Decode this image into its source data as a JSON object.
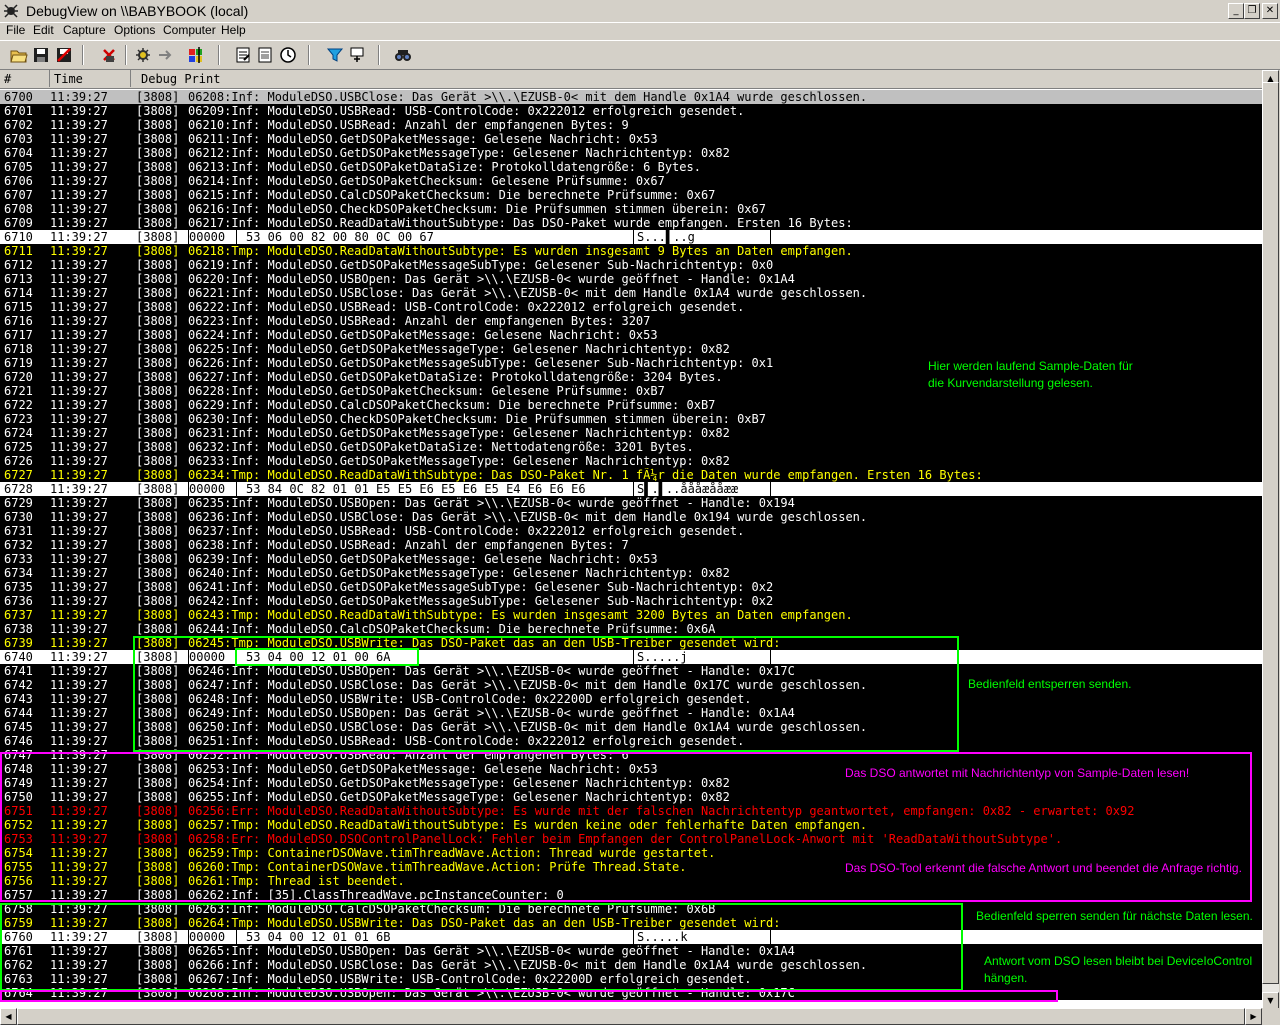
{
  "window": {
    "title": "DebugView on \\\\BABYBOOK (local)",
    "minimize_glyph": "_",
    "restore_glyph": "❐",
    "close_glyph": "✕"
  },
  "menu": [
    "File",
    "Edit",
    "Capture",
    "Options",
    "Computer",
    "Help"
  ],
  "toolbar_icons": [
    "open-icon",
    "save-icon",
    "clear-save-icon",
    "erase-icon",
    "capture-icon",
    "autoscroll-icon",
    "capture-win32-icon",
    "clock-icon",
    "history-icon",
    "highlight-icon",
    "filter-icon",
    "find-icon"
  ],
  "columns": [
    "#",
    "Time",
    "Debug Print"
  ],
  "colors": {
    "row_bg": "#000000",
    "text_default": "#ffffff",
    "text_tmp": "#ffff00",
    "text_err": "#ff0000",
    "hex_row_bg": "#ffffff",
    "box_green": "#00ff00",
    "box_magenta": "#ff00ff"
  },
  "rows": [
    {
      "n": "6700",
      "t": "11:39:27",
      "pid": "[3808]",
      "m": "06208:Inf: ModuleDSO.USBClose: Das Gerät >\\\\.\\EZUSB-0< mit dem Handle 0x1A4 wurde geschlossen.",
      "k": "sel"
    },
    {
      "n": "6701",
      "t": "11:39:27",
      "pid": "[3808]",
      "m": "06209:Inf: ModuleDSO.USBRead: USB-ControlCode: 0x222012 erfolgreich gesendet.",
      "k": "inf"
    },
    {
      "n": "6702",
      "t": "11:39:27",
      "pid": "[3808]",
      "m": "06210:Inf: ModuleDSO.USBRead: Anzahl der empfangenen Bytes: 9",
      "k": "inf"
    },
    {
      "n": "6703",
      "t": "11:39:27",
      "pid": "[3808]",
      "m": "06211:Inf: ModuleDSO.GetDSOPaketMessage: Gelesene Nachricht: 0x53",
      "k": "inf"
    },
    {
      "n": "6704",
      "t": "11:39:27",
      "pid": "[3808]",
      "m": "06212:Inf: ModuleDSO.GetDSOPaketMessageType: Gelesener Nachrichtentyp: 0x82",
      "k": "inf"
    },
    {
      "n": "6705",
      "t": "11:39:27",
      "pid": "[3808]",
      "m": "06213:Inf: ModuleDSO.GetDSOPaketDataSize: Protokolldatengröße: 6 Bytes.",
      "k": "inf"
    },
    {
      "n": "6706",
      "t": "11:39:27",
      "pid": "[3808]",
      "m": "06214:Inf: ModuleDSO.GetDSOPaketChecksum: Gelesene Prüfsumme: 0x67",
      "k": "inf"
    },
    {
      "n": "6707",
      "t": "11:39:27",
      "pid": "[3808]",
      "m": "06215:Inf: ModuleDSO.CalcDSOPaketChecksum: Die berechnete Prüfsumme: 0x67",
      "k": "inf"
    },
    {
      "n": "6708",
      "t": "11:39:27",
      "pid": "[3808]",
      "m": "06216:Inf: ModuleDSO.CheckDSOPaketChecksum: Die Prüfsummen stimmen überein: 0x67",
      "k": "inf"
    },
    {
      "n": "6709",
      "t": "11:39:27",
      "pid": "[3808]",
      "m": "06217:Inf: ModuleDSO.ReadDataWithoutSubtype: Das DSO-Paket wurde empfangen. Ersten 16 Bytes:",
      "k": "inf"
    },
    {
      "n": "6710",
      "t": "11:39:27",
      "pid": "[3808]",
      "m": "00000",
      "hex": "53 06 00 82 00 80 0C 00 67",
      "asc": "S...▌..g",
      "k": "hex"
    },
    {
      "n": "6711",
      "t": "11:39:27",
      "pid": "[3808]",
      "m": "06218:Tmp: ModuleDSO.ReadDataWithoutSubtype: Es wurden insgesamt 9 Bytes an Daten empfangen.",
      "k": "tmp"
    },
    {
      "n": "6712",
      "t": "11:39:27",
      "pid": "[3808]",
      "m": "06219:Inf: ModuleDSO.GetDSOPaketMessageSubType: Gelesener Sub-Nachrichtentyp: 0x0",
      "k": "inf"
    },
    {
      "n": "6713",
      "t": "11:39:27",
      "pid": "[3808]",
      "m": "06220:Inf: ModuleDSO.USBOpen: Das Gerät >\\\\.\\EZUSB-0< wurde geöffnet - Handle: 0x1A4",
      "k": "inf"
    },
    {
      "n": "6714",
      "t": "11:39:27",
      "pid": "[3808]",
      "m": "06221:Inf: ModuleDSO.USBClose: Das Gerät >\\\\.\\EZUSB-0< mit dem Handle 0x1A4 wurde geschlossen.",
      "k": "inf"
    },
    {
      "n": "6715",
      "t": "11:39:27",
      "pid": "[3808]",
      "m": "06222:Inf: ModuleDSO.USBRead: USB-ControlCode: 0x222012 erfolgreich gesendet.",
      "k": "inf"
    },
    {
      "n": "6716",
      "t": "11:39:27",
      "pid": "[3808]",
      "m": "06223:Inf: ModuleDSO.USBRead: Anzahl der empfangenen Bytes: 3207",
      "k": "inf"
    },
    {
      "n": "6717",
      "t": "11:39:27",
      "pid": "[3808]",
      "m": "06224:Inf: ModuleDSO.GetDSOPaketMessage: Gelesene Nachricht: 0x53",
      "k": "inf"
    },
    {
      "n": "6718",
      "t": "11:39:27",
      "pid": "[3808]",
      "m": "06225:Inf: ModuleDSO.GetDSOPaketMessageType: Gelesener Nachrichtentyp: 0x82",
      "k": "inf"
    },
    {
      "n": "6719",
      "t": "11:39:27",
      "pid": "[3808]",
      "m": "06226:Inf: ModuleDSO.GetDSOPaketMessageSubType: Gelesener Sub-Nachrichtentyp: 0x1",
      "k": "inf"
    },
    {
      "n": "6720",
      "t": "11:39:27",
      "pid": "[3808]",
      "m": "06227:Inf: ModuleDSO.GetDSOPaketDataSize: Protokolldatengröße: 3204 Bytes.",
      "k": "inf"
    },
    {
      "n": "6721",
      "t": "11:39:27",
      "pid": "[3808]",
      "m": "06228:Inf: ModuleDSO.GetDSOPaketChecksum: Gelesene Prüfsumme: 0xB7",
      "k": "inf"
    },
    {
      "n": "6722",
      "t": "11:39:27",
      "pid": "[3808]",
      "m": "06229:Inf: ModuleDSO.CalcDSOPaketChecksum: Die berechnete Prüfsumme: 0xB7",
      "k": "inf"
    },
    {
      "n": "6723",
      "t": "11:39:27",
      "pid": "[3808]",
      "m": "06230:Inf: ModuleDSO.CheckDSOPaketChecksum: Die Prüfsummen stimmen überein: 0xB7",
      "k": "inf"
    },
    {
      "n": "6724",
      "t": "11:39:27",
      "pid": "[3808]",
      "m": "06231:Inf: ModuleDSO.GetDSOPaketMessageType: Gelesener Nachrichtentyp: 0x82",
      "k": "inf"
    },
    {
      "n": "6725",
      "t": "11:39:27",
      "pid": "[3808]",
      "m": "06232:Inf: ModuleDSO.GetDSOPaketDataSize: Nettodatengröße: 3201 Bytes.",
      "k": "inf"
    },
    {
      "n": "6726",
      "t": "11:39:27",
      "pid": "[3808]",
      "m": "06233:Inf: ModuleDSO.GetDSOPaketMessageType: Gelesener Nachrichtentyp: 0x82",
      "k": "inf"
    },
    {
      "n": "6727",
      "t": "11:39:27",
      "pid": "[3808]",
      "m": "06234:Tmp: ModuleDSO.ReadDataWithSubtype: Das DSO-Paket Nr. 1 fÃ¼r die Daten wurde empfangen. Ersten 16 Bytes:",
      "k": "tmp"
    },
    {
      "n": "6728",
      "t": "11:39:27",
      "pid": "[3808]",
      "m": "00000",
      "hex": "53 84 0C 82 01 01 E5 E5 E6 E5 E6 E5 E4 E6 E6 E6",
      "asc": "S▌.▌..åååæååææ",
      "k": "hex"
    },
    {
      "n": "6729",
      "t": "11:39:27",
      "pid": "[3808]",
      "m": "06235:Inf: ModuleDSO.USBOpen: Das Gerät >\\\\.\\EZUSB-0< wurde geöffnet - Handle: 0x194",
      "k": "inf"
    },
    {
      "n": "6730",
      "t": "11:39:27",
      "pid": "[3808]",
      "m": "06236:Inf: ModuleDSO.USBClose: Das Gerät >\\\\.\\EZUSB-0< mit dem Handle 0x194 wurde geschlossen.",
      "k": "inf"
    },
    {
      "n": "6731",
      "t": "11:39:27",
      "pid": "[3808]",
      "m": "06237:Inf: ModuleDSO.USBRead: USB-ControlCode: 0x222012 erfolgreich gesendet.",
      "k": "inf"
    },
    {
      "n": "6732",
      "t": "11:39:27",
      "pid": "[3808]",
      "m": "06238:Inf: ModuleDSO.USBRead: Anzahl der empfangenen Bytes: 7",
      "k": "inf"
    },
    {
      "n": "6733",
      "t": "11:39:27",
      "pid": "[3808]",
      "m": "06239:Inf: ModuleDSO.GetDSOPaketMessage: Gelesene Nachricht: 0x53",
      "k": "inf"
    },
    {
      "n": "6734",
      "t": "11:39:27",
      "pid": "[3808]",
      "m": "06240:Inf: ModuleDSO.GetDSOPaketMessageType: Gelesener Nachrichtentyp: 0x82",
      "k": "inf"
    },
    {
      "n": "6735",
      "t": "11:39:27",
      "pid": "[3808]",
      "m": "06241:Inf: ModuleDSO.GetDSOPaketMessageSubType: Gelesener Sub-Nachrichtentyp: 0x2",
      "k": "inf"
    },
    {
      "n": "6736",
      "t": "11:39:27",
      "pid": "[3808]",
      "m": "06242:Inf: ModuleDSO.GetDSOPaketMessageSubType: Gelesener Sub-Nachrichtentyp: 0x2",
      "k": "inf"
    },
    {
      "n": "6737",
      "t": "11:39:27",
      "pid": "[3808]",
      "m": "06243:Tmp: ModuleDSO.ReadDataWithSubtype: Es wurden insgesamt 3200 Bytes an Daten empfangen.",
      "k": "tmp"
    },
    {
      "n": "6738",
      "t": "11:39:27",
      "pid": "[3808]",
      "m": "06244:Inf: ModuleDSO.CalcDSOPaketChecksum: Die berechnete Prüfsumme: 0x6A",
      "k": "inf"
    },
    {
      "n": "6739",
      "t": "11:39:27",
      "pid": "[3808]",
      "m": "06245:Tmp: ModuleDSO.USBWrite: Das DSO-Paket das an den USB-Treiber gesendet wird:",
      "k": "tmp"
    },
    {
      "n": "6740",
      "t": "11:39:27",
      "pid": "[3808]",
      "m": "00000",
      "hex": "53 04 00 12 01 00 6A",
      "asc": "S.....j",
      "k": "hex"
    },
    {
      "n": "6741",
      "t": "11:39:27",
      "pid": "[3808]",
      "m": "06246:Inf: ModuleDSO.USBOpen: Das Gerät >\\\\.\\EZUSB-0< wurde geöffnet - Handle: 0x17C",
      "k": "inf"
    },
    {
      "n": "6742",
      "t": "11:39:27",
      "pid": "[3808]",
      "m": "06247:Inf: ModuleDSO.USBClose: Das Gerät >\\\\.\\EZUSB-0< mit dem Handle 0x17C wurde geschlossen.",
      "k": "inf"
    },
    {
      "n": "6743",
      "t": "11:39:27",
      "pid": "[3808]",
      "m": "06248:Inf: ModuleDSO.USBWrite: USB-ControlCode: 0x22200D erfolgreich gesendet.",
      "k": "inf"
    },
    {
      "n": "6744",
      "t": "11:39:27",
      "pid": "[3808]",
      "m": "06249:Inf: ModuleDSO.USBOpen: Das Gerät >\\\\.\\EZUSB-0< wurde geöffnet - Handle: 0x1A4",
      "k": "inf"
    },
    {
      "n": "6745",
      "t": "11:39:27",
      "pid": "[3808]",
      "m": "06250:Inf: ModuleDSO.USBClose: Das Gerät >\\\\.\\EZUSB-0< mit dem Handle 0x1A4 wurde geschlossen.",
      "k": "inf"
    },
    {
      "n": "6746",
      "t": "11:39:27",
      "pid": "[3808]",
      "m": "06251:Inf: ModuleDSO.USBRead: USB-ControlCode: 0x222012 erfolgreich gesendet.",
      "k": "inf"
    },
    {
      "n": "6747",
      "t": "11:39:27",
      "pid": "[3808]",
      "m": "06252:Inf: ModuleDSO.USBRead: Anzahl der empfangenen Bytes: 6",
      "k": "inf"
    },
    {
      "n": "6748",
      "t": "11:39:27",
      "pid": "[3808]",
      "m": "06253:Inf: ModuleDSO.GetDSOPaketMessage: Gelesene Nachricht: 0x53",
      "k": "inf"
    },
    {
      "n": "6749",
      "t": "11:39:27",
      "pid": "[3808]",
      "m": "06254:Inf: ModuleDSO.GetDSOPaketMessageType: Gelesener Nachrichtentyp: 0x82",
      "k": "inf"
    },
    {
      "n": "6750",
      "t": "11:39:27",
      "pid": "[3808]",
      "m": "06255:Inf: ModuleDSO.GetDSOPaketMessageType: Gelesener Nachrichtentyp: 0x82",
      "k": "inf"
    },
    {
      "n": "6751",
      "t": "11:39:27",
      "pid": "[3808]",
      "m": "06256:Err: ModuleDSO.ReadDataWithoutSubtype: Es wurde mit der falschen Nachrichtentyp geantwortet, empfangen: 0x82 - erwartet: 0x92",
      "k": "err"
    },
    {
      "n": "6752",
      "t": "11:39:27",
      "pid": "[3808]",
      "m": "06257:Tmp: ModuleDSO.ReadDataWithoutSubtype: Es wurden keine oder fehlerhafte Daten empfangen.",
      "k": "tmp"
    },
    {
      "n": "6753",
      "t": "11:39:27",
      "pid": "[3808]",
      "m": "06258:Err: ModuleDSO.DSOControlPanelLock: Fehler beim Empfangen der ControlPanelLock-Anwort mit 'ReadDataWithoutSubtype'.",
      "k": "err"
    },
    {
      "n": "6754",
      "t": "11:39:27",
      "pid": "[3808]",
      "m": "06259:Tmp: ContainerDSOWave.timThreadWave.Action: Thread wurde gestartet.",
      "k": "tmp"
    },
    {
      "n": "6755",
      "t": "11:39:27",
      "pid": "[3808]",
      "m": "06260:Tmp: ContainerDSOWave.timThreadWave.Action: Prüfe Thread.State.",
      "k": "tmp"
    },
    {
      "n": "6756",
      "t": "11:39:27",
      "pid": "[3808]",
      "m": "06261:Tmp: Thread ist beendet.",
      "k": "tmp"
    },
    {
      "n": "6757",
      "t": "11:39:27",
      "pid": "[3808]",
      "m": "06262:Inf: [35].ClassThreadWave.pcInstanceCounter: 0",
      "k": "inf"
    },
    {
      "n": "6758",
      "t": "11:39:27",
      "pid": "[3808]",
      "m": "06263:Inf: ModuleDSO.CalcDSOPaketChecksum: Die berechnete Prüfsumme: 0x6B",
      "k": "inf"
    },
    {
      "n": "6759",
      "t": "11:39:27",
      "pid": "[3808]",
      "m": "06264:Tmp: ModuleDSO.USBWrite: Das DSO-Paket das an den USB-Treiber gesendet wird:",
      "k": "tmp"
    },
    {
      "n": "6760",
      "t": "11:39:27",
      "pid": "[3808]",
      "m": "00000",
      "hex": "53 04 00 12 01 01 6B",
      "asc": "S.....k",
      "k": "hex"
    },
    {
      "n": "6761",
      "t": "11:39:27",
      "pid": "[3808]",
      "m": "06265:Inf: ModuleDSO.USBOpen: Das Gerät >\\\\.\\EZUSB-0< wurde geöffnet - Handle: 0x1A4",
      "k": "inf"
    },
    {
      "n": "6762",
      "t": "11:39:27",
      "pid": "[3808]",
      "m": "06266:Inf: ModuleDSO.USBClose: Das Gerät >\\\\.\\EZUSB-0< mit dem Handle 0x1A4 wurde geschlossen.",
      "k": "inf"
    },
    {
      "n": "6763",
      "t": "11:39:27",
      "pid": "[3808]",
      "m": "06267:Inf: ModuleDSO.USBWrite: USB-ControlCode: 0x22200D erfolgreich gesendet.",
      "k": "inf"
    },
    {
      "n": "6764",
      "t": "11:39:27",
      "pid": "[3808]",
      "m": "06268:Inf: ModuleDSO.USBOpen: Das Gerät >\\\\.\\EZUSB-0< wurde geöffnet - Handle: 0x17C",
      "k": "inf"
    }
  ],
  "annotations": {
    "sample_data": {
      "line1": "Hier werden laufend Sample-Daten für",
      "line2": "die Kurvendarstellung gelesen."
    },
    "unlock_panel": {
      "line1": "Bedienfeld entsperren senden."
    },
    "wrong_type": {
      "line1": "Das DSO antwortet mit Nachrichtentyp von Sample-Daten lesen!"
    },
    "tool_detects": {
      "line1": "Das DSO-Tool erkennt die falsche Antwort und beendet die Anfrage richtig."
    },
    "lock_panel": {
      "line1": "Bedienfeld sperren senden für nächste Daten lesen."
    },
    "device_io": {
      "line1": "Antwort vom DSO lesen bleibt bei DeviceIoControl",
      "line2": "hängen."
    }
  }
}
